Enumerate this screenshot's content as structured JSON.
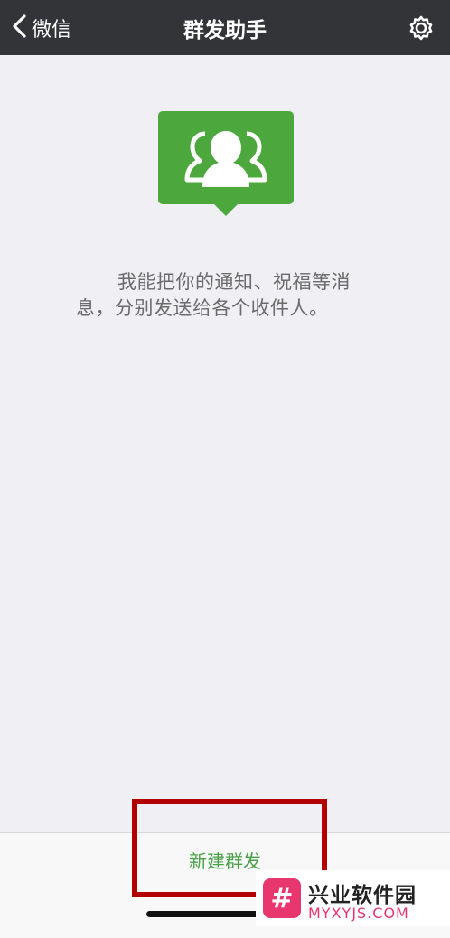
{
  "navbar": {
    "back_label": "微信",
    "title": "群发助手",
    "back_icon": "chevron-left-icon",
    "settings_icon": "gear-icon"
  },
  "hero": {
    "icon": "group-chat-icon",
    "color": "#4ca83c"
  },
  "description": {
    "line1": "我能把你的通知、祝福等消",
    "line2": "息，分别发送给各个收件人。"
  },
  "bottom": {
    "new_broadcast_label": "新建群发",
    "accent": "#4aa14a"
  },
  "watermark": {
    "logo_glyph": "#",
    "name": "兴业软件园",
    "url": "MYXYJS.COM"
  },
  "colors": {
    "navbar_bg": "#333438",
    "page_bg": "#efeff4",
    "highlight": "#b30000",
    "brand_pink": "#e8366f"
  }
}
